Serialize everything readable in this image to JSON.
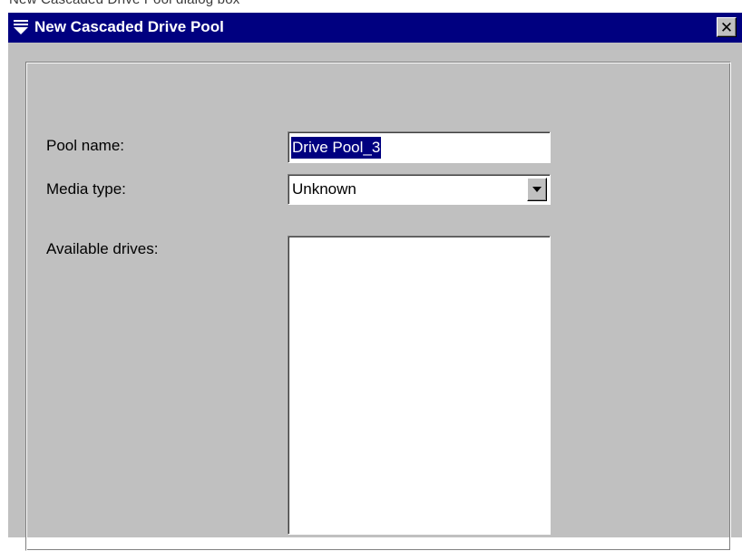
{
  "caption": "New Cascaded Drive Pool dialog box",
  "dialog": {
    "title": "New Cascaded Drive Pool",
    "close_symbol": "✕",
    "title_icon": "dropdown-triangle-icon",
    "close_icon": "close-icon"
  },
  "form": {
    "pool_name_label": "Pool name:",
    "pool_name_value": "Drive Pool_3",
    "media_type_label": "Media type:",
    "media_type_value": "Unknown",
    "available_drives_label": "Available drives:",
    "available_drives": []
  },
  "colors": {
    "titlebar": "#000080",
    "face": "#c0c0c0",
    "selection": "#000080",
    "field": "#ffffff"
  }
}
